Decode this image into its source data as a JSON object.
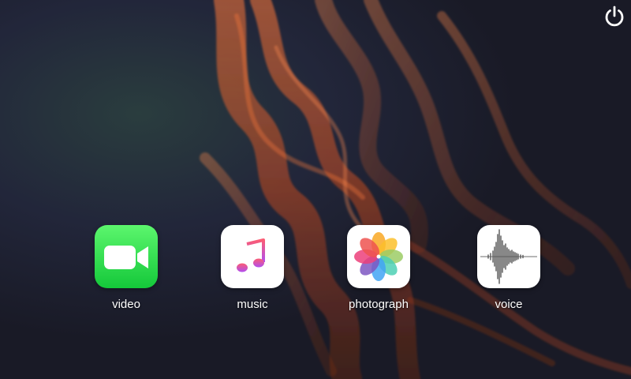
{
  "system": {
    "power_icon": "power-icon"
  },
  "apps": [
    {
      "id": "video",
      "label": "video",
      "icon": "video-camera-icon",
      "color": "#2bd44b"
    },
    {
      "id": "music",
      "label": "music",
      "icon": "music-note-icon",
      "color": "#ffffff"
    },
    {
      "id": "photograph",
      "label": "photograph",
      "icon": "photos-flower-icon",
      "color": "#ffffff"
    },
    {
      "id": "voice",
      "label": "voice",
      "icon": "waveform-icon",
      "color": "#ffffff"
    }
  ],
  "theme": {
    "background": "#1c1d2b",
    "accent_flame": "#ff6a2a",
    "label_color": "#ffffff"
  }
}
